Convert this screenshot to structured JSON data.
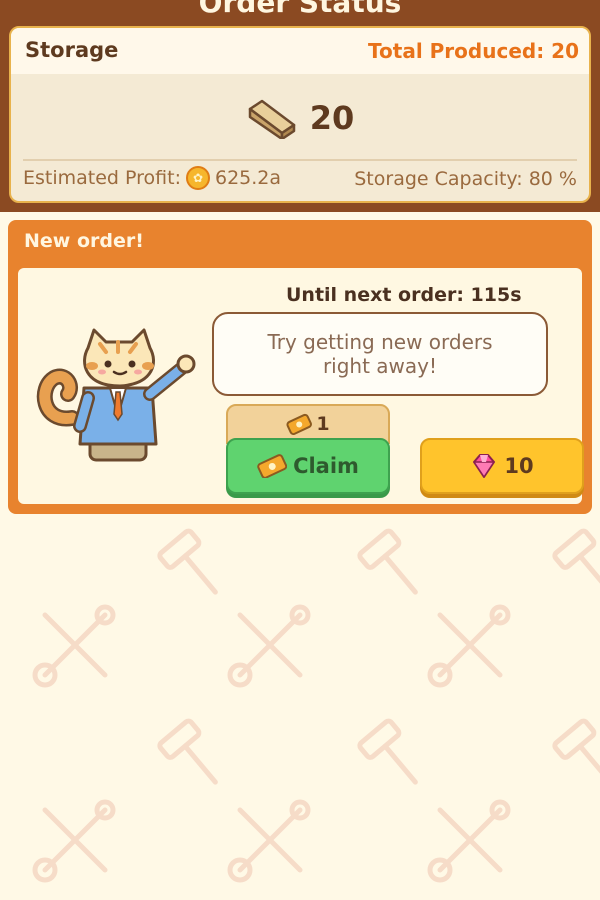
{
  "header": {
    "title": "Order Status"
  },
  "storage": {
    "label": "Storage",
    "total_produced_label": "Total Produced: 20",
    "item_icon": "wood-plank-icon",
    "count": "20",
    "estimated_profit_label": "Estimated Profit:",
    "estimated_profit_value": "625.2a",
    "storage_capacity": "Storage Capacity: 80 %"
  },
  "order": {
    "title": "New order!",
    "timer": "Until next order: 115s",
    "bubble_line1": "Try getting new orders",
    "bubble_line2": "right away!",
    "ticket_count": "1",
    "claim_label": "Claim",
    "gem_cost": "10"
  },
  "colors": {
    "header_bg": "#8b4a22",
    "accent_orange": "#e8832e",
    "claim_green": "#5fd36f",
    "gem_yellow": "#ffc42c",
    "gem_pink": "#ff4f9a"
  }
}
